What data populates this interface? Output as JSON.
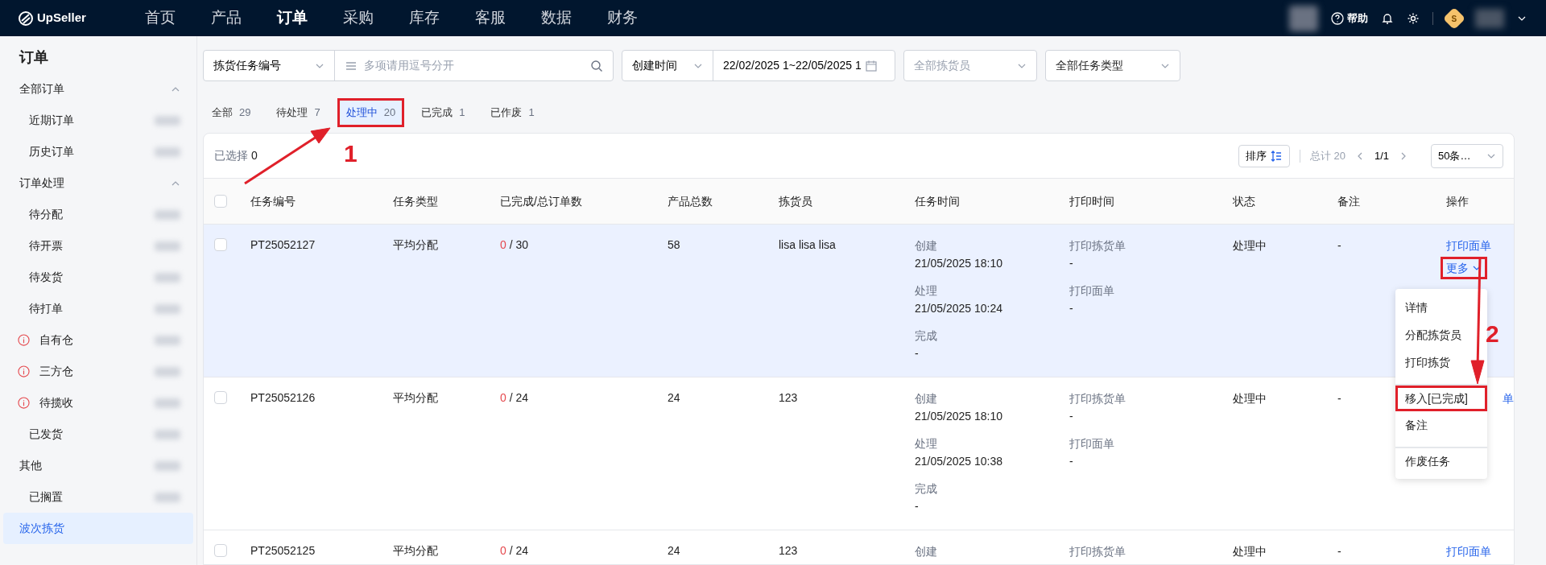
{
  "nav": {
    "logo": "UpSeller",
    "items": [
      {
        "label": "首页",
        "selected": false
      },
      {
        "label": "产品",
        "selected": false
      },
      {
        "label": "订单",
        "selected": true
      },
      {
        "label": "采购",
        "selected": false
      },
      {
        "label": "库存",
        "selected": false
      },
      {
        "label": "客服",
        "selected": false
      },
      {
        "label": "数据",
        "selected": false
      },
      {
        "label": "财务",
        "selected": false
      }
    ],
    "help": "帮助",
    "avatar_letter": "S"
  },
  "sidebar": {
    "title": "订单",
    "items": [
      {
        "label": "全部订单",
        "expanded": true,
        "children": [
          {
            "label": "近期订单",
            "selected": false
          },
          {
            "label": "历史订单",
            "selected": false
          }
        ]
      },
      {
        "label": "订单处理",
        "expanded": true,
        "children": [
          {
            "label": "待分配",
            "selected": false,
            "alert": false
          },
          {
            "label": "待开票",
            "selected": false,
            "alert": false
          },
          {
            "label": "待发货",
            "selected": false,
            "alert": false
          },
          {
            "label": "待打单",
            "selected": false,
            "alert": false
          },
          {
            "label": "自有仓",
            "selected": false,
            "alert": true
          },
          {
            "label": "三方仓",
            "selected": false,
            "alert": true
          },
          {
            "label": "待揽收",
            "selected": false,
            "alert": true
          },
          {
            "label": "已发货",
            "selected": false,
            "alert": false
          }
        ]
      },
      {
        "label": "其他",
        "children": [
          {
            "label": "已搁置",
            "selected": false,
            "alert": false
          }
        ]
      },
      {
        "label": "波次拣货",
        "selected": true
      }
    ]
  },
  "filters": {
    "search_type": "拣货任务编号",
    "search_placeholder": "多项请用逗号分开",
    "date_type": "创建时间",
    "date_range": "22/02/2025 1~22/05/2025 1",
    "picker_placeholder": "全部拣货员",
    "task_type": "全部任务类型"
  },
  "tabs": [
    {
      "label": "全部",
      "count": "29",
      "selected": false,
      "highlighted": false
    },
    {
      "label": "待处理",
      "count": "7",
      "selected": false,
      "highlighted": false
    },
    {
      "label": "处理中",
      "count": "20",
      "selected": true,
      "highlighted": true
    },
    {
      "label": "已完成",
      "count": "1",
      "selected": false,
      "highlighted": false
    },
    {
      "label": "已作废",
      "count": "1",
      "selected": false,
      "highlighted": false
    }
  ],
  "toolbar": {
    "selected_label": "已选择",
    "selected_count": "0",
    "sort": "排序",
    "total": "总计 20",
    "page": "1/1",
    "page_size": "50条…"
  },
  "table": {
    "select_all_checked": false,
    "columns": [
      "任务编号",
      "任务类型",
      "已完成/总订单数",
      "产品总数",
      "拣货员",
      "任务时间",
      "打印时间",
      "状态",
      "备注",
      "操作"
    ],
    "rows": [
      {
        "id": "PT25052127",
        "type": "平均分配",
        "done": "0",
        "total": "/ 30",
        "products": "58",
        "picker": "lisa lisa lisa",
        "times": [
          {
            "label": "创建",
            "value": "21/05/2025 18:10"
          },
          {
            "label": "处理",
            "value": "21/05/2025 10:24"
          },
          {
            "label": "完成",
            "value": "-"
          }
        ],
        "prints": [
          {
            "label": "打印拣货单",
            "value": "-"
          },
          {
            "label": "打印面单",
            "value": "-"
          }
        ],
        "status": "处理中",
        "note": "-",
        "hovered": true,
        "checked": false,
        "action": "打印面单",
        "more": {
          "label": "更多",
          "highlighted": true
        },
        "menu": [
          {
            "label": "详情",
            "highlighted": false,
            "divider": false
          },
          {
            "label": "分配拣货员",
            "highlighted": false,
            "divider": false
          },
          {
            "label": "打印拣货",
            "highlighted": false,
            "divider": false
          },
          {
            "label": "移入[已完成]",
            "highlighted": true,
            "divider": true
          },
          {
            "label": "备注",
            "highlighted": false,
            "divider": false
          },
          {
            "label": "作废任务",
            "highlighted": false,
            "divider": true
          }
        ]
      },
      {
        "id": "PT25052126",
        "type": "平均分配",
        "done": "0",
        "total": "/ 24",
        "products": "24",
        "picker": "123",
        "times": [
          {
            "label": "创建",
            "value": "21/05/2025 18:10"
          },
          {
            "label": "处理",
            "value": "21/05/2025 10:38"
          },
          {
            "label": "完成",
            "value": "-"
          }
        ],
        "prints": [
          {
            "label": "打印拣货单",
            "value": "-"
          },
          {
            "label": "打印面单",
            "value": "-"
          }
        ],
        "status": "处理中",
        "note": "-",
        "hovered": false,
        "checked": false,
        "action": "单"
      },
      {
        "id": "PT25052125",
        "type": "平均分配",
        "done": "0",
        "total": "/ 24",
        "products": "24",
        "picker": "123",
        "times": [
          {
            "label": "创建"
          }
        ],
        "prints": [
          {
            "label": "打印拣货单"
          }
        ],
        "status": "处理中",
        "note": "-",
        "hovered": false,
        "checked": false,
        "action": "打印面单"
      }
    ]
  },
  "annotations": [
    {
      "text": "1"
    },
    {
      "text": "2"
    }
  ]
}
